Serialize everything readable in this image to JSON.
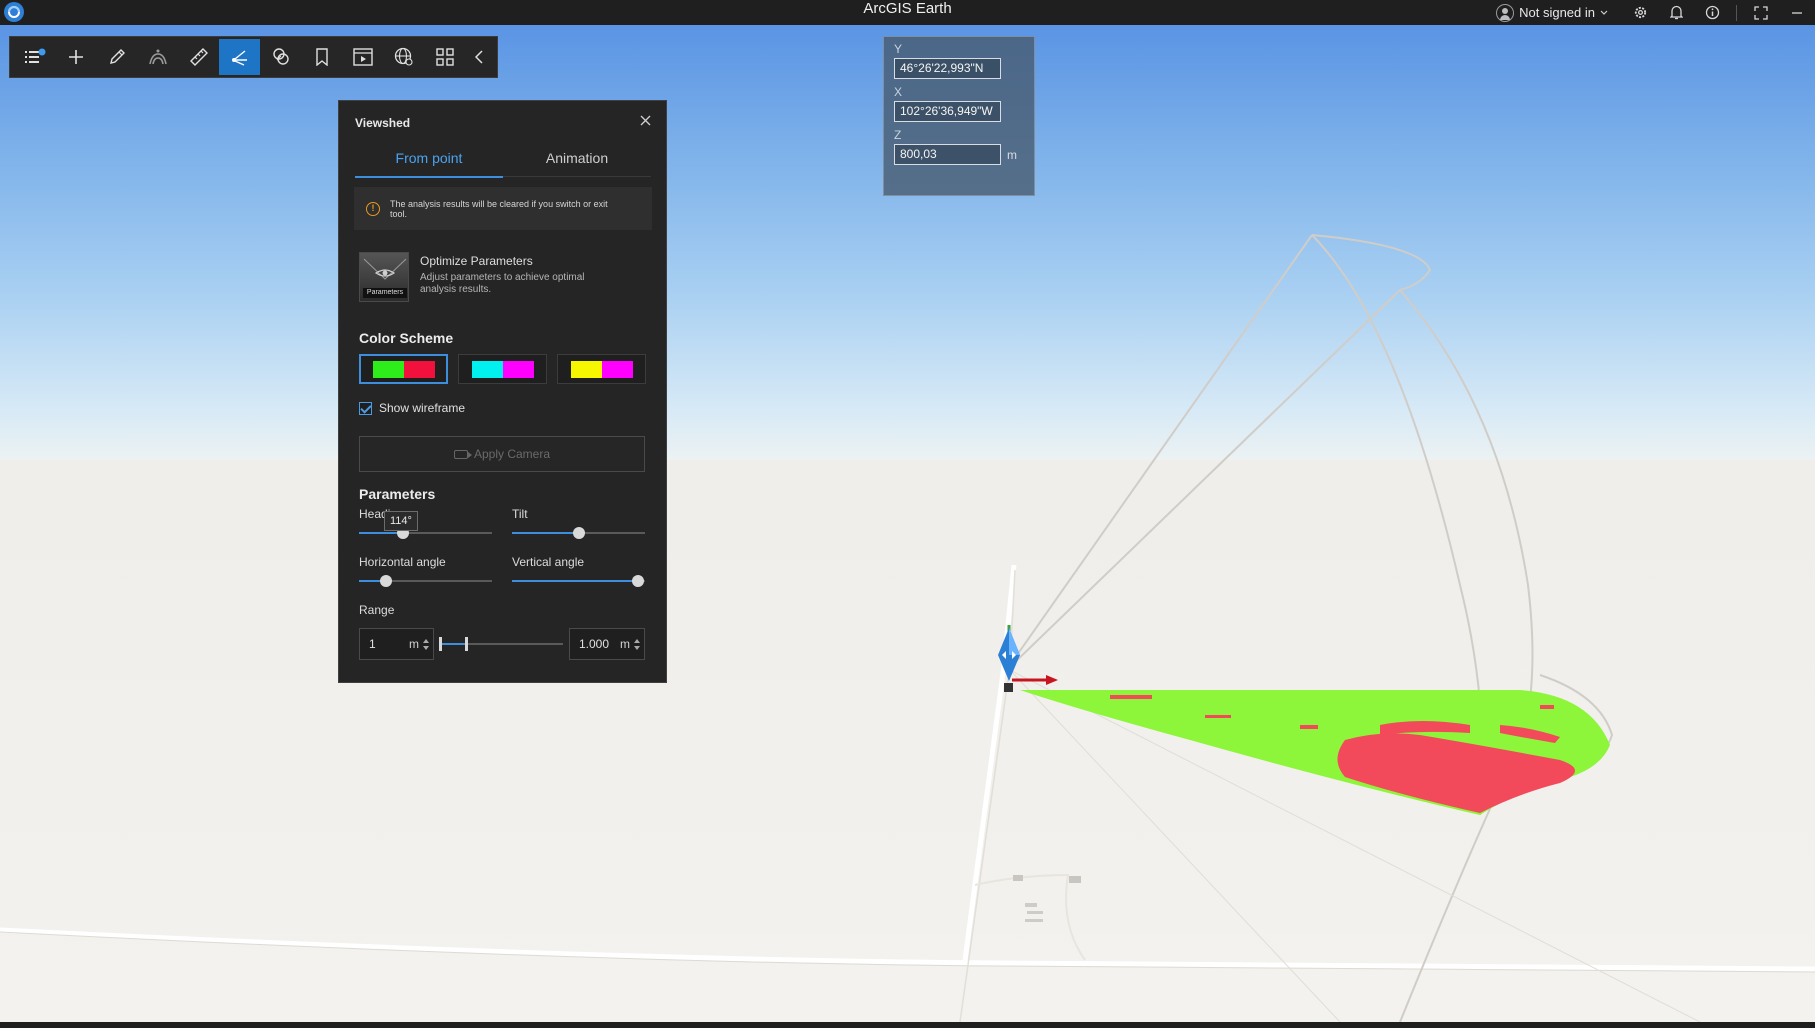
{
  "titlebar": {
    "app_title": "ArcGIS Earth",
    "user_label": "Not signed in",
    "icons": [
      "settings-icon",
      "bell-icon",
      "info-icon",
      "fullscreen-icon"
    ]
  },
  "toolbar": {
    "tools": [
      "layers",
      "add",
      "sketch",
      "elevation-profile",
      "measure",
      "viewshed",
      "interactive-analysis",
      "bookmarks",
      "presentation",
      "globe-settings",
      "apps",
      "collapse"
    ],
    "active_tool": "viewshed"
  },
  "coords": {
    "y_label": "Y",
    "y_value": "46°26'22,993\"N",
    "x_label": "X",
    "x_value": "102°26'36,949\"W",
    "z_label": "Z",
    "z_value": "800,03",
    "z_unit": "m"
  },
  "viewshed": {
    "title": "Viewshed",
    "tabs": [
      "From point",
      "Animation"
    ],
    "active_tab": "From point",
    "notice": "The analysis results will be cleared if you switch or exit tool.",
    "optimize_title": "Optimize Parameters",
    "optimize_desc": "Adjust parameters to achieve optimal analysis results.",
    "optimize_thumb_label": "Parameters",
    "color_scheme_title": "Color Scheme",
    "color_schemes": [
      {
        "visible": "#2dee1a",
        "hidden": "#f2103c"
      },
      {
        "visible": "#00f0f0",
        "hidden": "#ff00ff"
      },
      {
        "visible": "#f6f600",
        "hidden": "#ff00ff"
      }
    ],
    "selected_scheme": 0,
    "show_wireframe_label": "Show wireframe",
    "show_wireframe": true,
    "apply_camera_label": "Apply Camera",
    "parameters_title": "Parameters",
    "heading_label": "Heading",
    "heading_tooltip": "114°",
    "heading_fraction": 0.33,
    "tilt_label": "Tilt",
    "tilt_fraction": 0.5,
    "horizontal_angle_label": "Horizontal angle",
    "horizontal_angle_fraction": 0.2,
    "vertical_angle_label": "Vertical angle",
    "vertical_angle_fraction": 0.95,
    "range_label": "Range",
    "range_min_value": "1",
    "range_min_unit": "m",
    "range_max_value": "1.000",
    "range_max_unit": "m"
  }
}
